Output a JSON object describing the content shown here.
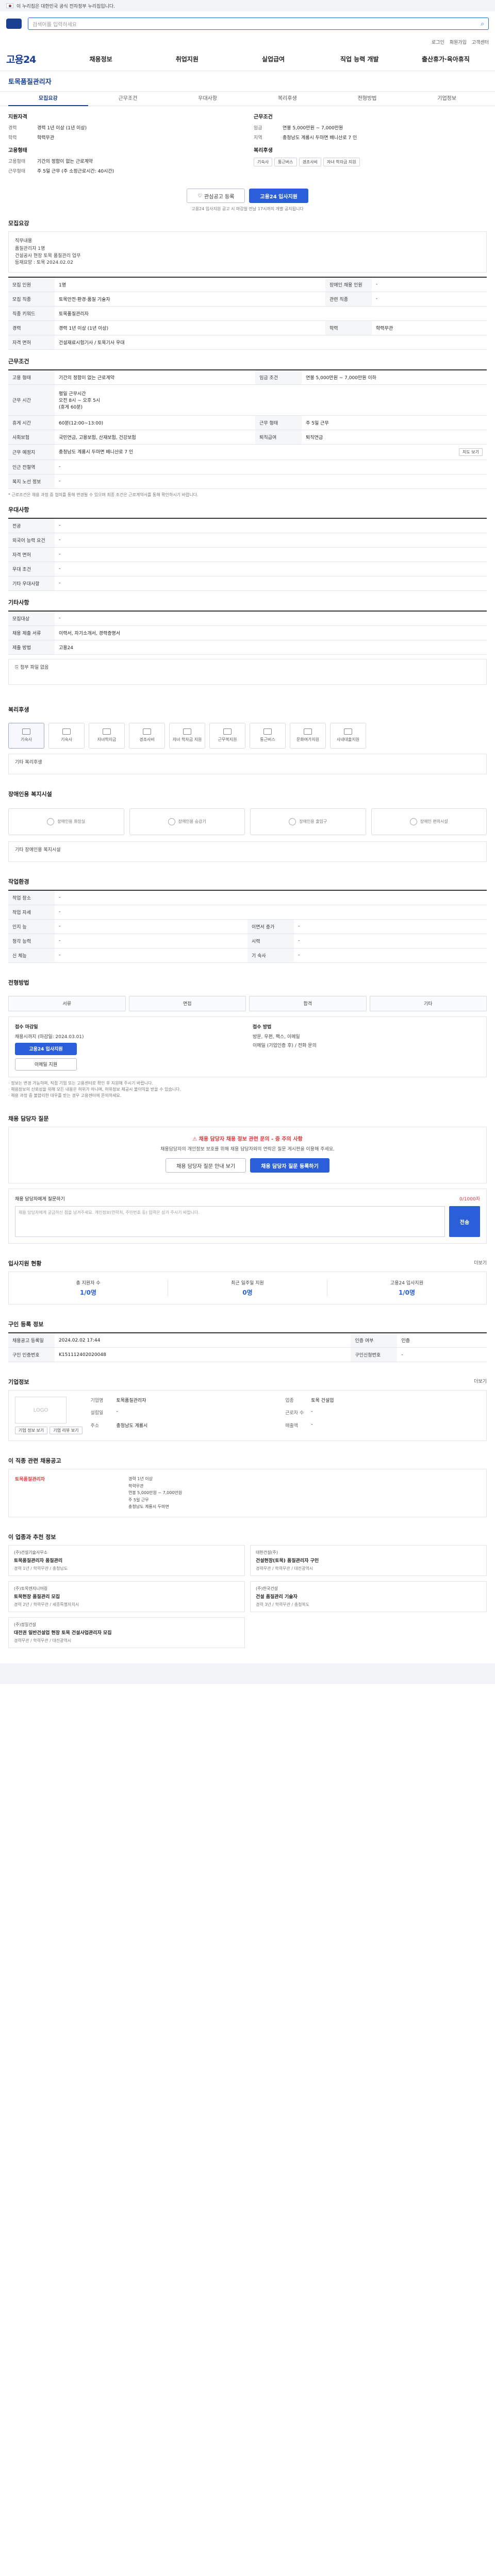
{
  "gov_banner": "이 누리집은 대한민국 공식 전자정부 누리집입니다.",
  "search": {
    "placeholder": "검색어를 입력하세요"
  },
  "util": [
    "로그인",
    "회원가입",
    "고객센터"
  ],
  "gnb": {
    "logo": "고용24",
    "items": [
      "채용정보",
      "취업지원",
      "실업급여",
      "직업 능력 개발",
      "출산휴가·육아휴직"
    ]
  },
  "job": {
    "title": "토목품질관리자",
    "status": "채용마감"
  },
  "tabs": [
    "모집요강",
    "근무조건",
    "우대사항",
    "복리후생",
    "전형방법",
    "기업정보"
  ],
  "summary": {
    "left_title": "지원자격",
    "left": [
      {
        "k": "경력",
        "v": "경력 1년 이상 (1년 이상)"
      },
      {
        "k": "학력",
        "v": "학력무관"
      }
    ],
    "left2_title": "고용형태",
    "left2": [
      {
        "k": "고용형태",
        "v": "기간의 정함이 없는 근로계약"
      },
      {
        "k": "근무형태",
        "v": "주 5일 근무 (주 소정근로시간: 40시간)"
      }
    ],
    "right_title": "근무조건",
    "right": [
      {
        "k": "임금",
        "v": "연봉 5,000만원 ~ 7,000만원"
      },
      {
        "k": "지역",
        "v": "충청남도 계룡시 두마면 배니산로 7 인"
      }
    ],
    "right2_title": "복리후생",
    "chips": [
      "기숙사",
      "통근버스",
      "경조사비",
      "자녀 학자금 지원"
    ]
  },
  "buttons": {
    "save": "관심공고 등록",
    "apply": "고용24 입사지원"
  },
  "notice_small": "고용24 입사지원 공고 시 마감일 전날 17시까지 개별 공지됩니다",
  "recruit": {
    "title": "모집요강",
    "job_content_label": "직무내용",
    "job_content": "품질관리자 1명\n건설공사 현장 토목 품질관리 업무\n등재요망 : 토목 2024.02.02",
    "rows": [
      {
        "k": "모집 인원",
        "v": "1명",
        "k2": "장애인 채용 인원",
        "v2": "-"
      },
      {
        "k": "모집 직종",
        "v": "토목안전·환경·품질 기술자",
        "k2": "관련 직종",
        "v2": "-"
      },
      {
        "k": "직종 키워드",
        "v": "토목품질관리자",
        "k2": "",
        "v2": ""
      },
      {
        "k": "경력",
        "v": "경력 1년 이상 (1년 이상)",
        "k2": "학력",
        "v2": "학력무관"
      },
      {
        "k": "자격 면허",
        "v": "건설재료시험기사 / 토목기사 우대",
        "k2": "",
        "v2": ""
      }
    ]
  },
  "conditions": {
    "title": "근무조건",
    "rows": [
      {
        "k": "고용 형태",
        "v": "기간의 정함이 없는 근로계약",
        "k2": "임금 조건",
        "v2": "연봉 5,000만원 ~ 7,000만원 이하"
      },
      {
        "k": "근무 시간",
        "v": "평일 근무시간\n오전 8시 ~ 오후 5시\n(휴게 60분)",
        "k2": "",
        "v2": ""
      },
      {
        "k": "휴게 시간",
        "v": "60분(12:00~13:00)",
        "k2": "근무 형태",
        "v2": "주 5일 근무"
      },
      {
        "k": "사회보험",
        "v": "국민연금, 고용보험, 산재보험, 건강보험",
        "k2": "퇴직급여",
        "v2": "퇴직연금"
      },
      {
        "k": "근무 예정지",
        "v": "충청남도 계룡시 두마면 배니산로 7 인",
        "k2": "",
        "v2": ""
      },
      {
        "k": "인근 전철역",
        "v": "-",
        "k2": "",
        "v2": ""
      },
      {
        "k": "복지 노선 정보",
        "v": "-",
        "k2": "",
        "v2": ""
      }
    ],
    "map_btn": "지도 보기",
    "footnote": "* 근로조건은 채용 과정 중 협의를 통해 변경될 수 있으며 최종 조건은 근로계약서를 통해 확인하시기 바랍니다."
  },
  "prefer": {
    "title": "우대사항",
    "rows": [
      {
        "k": "전공",
        "v": "-"
      },
      {
        "k": "외국어 능력 요건",
        "v": "-"
      },
      {
        "k": "자격 면허",
        "v": "-"
      },
      {
        "k": "우대 조건",
        "v": "-"
      },
      {
        "k": "기타 우대사항",
        "v": "-"
      }
    ]
  },
  "etc": {
    "title": "기타사항",
    "rows": [
      {
        "k": "모집대상",
        "v": "-"
      },
      {
        "k": "채용 제출 서류",
        "v": "이력서, 자기소개서, 경력증명서"
      },
      {
        "k": "제출 방법",
        "v": "고용24"
      }
    ],
    "attachment": "첨부 파일 없음"
  },
  "welfare": {
    "title": "복리후생",
    "items": [
      {
        "label": "기숙사",
        "on": true
      },
      {
        "label": "기숙사",
        "on": false
      },
      {
        "label": "자녀학자금",
        "on": false
      },
      {
        "label": "경조사비",
        "on": false
      },
      {
        "label": "자녀 학자금 지원",
        "on": false
      },
      {
        "label": "근무복지원",
        "on": false
      },
      {
        "label": "통근버스",
        "on": false
      },
      {
        "label": "문화여가지원",
        "on": false
      },
      {
        "label": "사내대출지원",
        "on": false
      }
    ],
    "note": "기타 복리후생"
  },
  "disability": {
    "title": "장애인용 복지시설",
    "items": [
      "장애인용 화장실",
      "장애인용 승강기",
      "장애인용 출입구",
      "장애인 편의시설"
    ],
    "note": "기타 장애인용 복지시설"
  },
  "jobenv": {
    "title": "작업환경",
    "rows": [
      {
        "k": "작업 장소",
        "v": "-",
        "k2": "",
        "v2": ""
      },
      {
        "k": "작업 자세",
        "v": "-",
        "k2": "",
        "v2": ""
      },
      {
        "k": "인지 능",
        "v": "-",
        "k2": "이면서 증가",
        "v2": "-"
      },
      {
        "k": "청각 능력",
        "v": "-",
        "k2": "시력",
        "v2": "-"
      },
      {
        "k": "신 체능",
        "v": "-",
        "k2": "기 숙사",
        "v2": "-"
      }
    ]
  },
  "process": {
    "title": "전형방법",
    "steps": [
      "서류",
      "면접",
      "합격",
      "기타"
    ]
  },
  "apply": {
    "left_title": "접수 마감일",
    "deadline": "채용시까지 (마감일: 2024.03.01)",
    "apply_btn": "고용24 입사지원",
    "mail_btn": "이메일 지원",
    "right_title": "접수 방법",
    "method": "방문, 우편, 팩스, 이메일",
    "contact": "이메일 (기업인증 후) / 전화 문의"
  },
  "apply_notes": [
    "· 정보는 변경 가능하며, 직접 기업 또는 고용센터로 확인 후 지원해 주시기 바랍니다.",
    "· 채용정보의 신뢰성을 위해 모든 내용은 허위가 아니며, 허위정보 제공시 불이익을 받을 수 있습니다.",
    "· 채용 과정 중 불합리한 대우를 받는 경우 고용센터에 문의하세요."
  ],
  "qa": {
    "title": "채용 담당자 질문",
    "warn": "채용 담당자 채용 정보 관련 문의 - 중 주의 사항",
    "desc": "채용담당자의 개인정보 보호를 위해 채용 담당자와의 연락은 질문 게시판을 이용해 주세요.",
    "btn1": "채용 담당자 질문 안내 보기",
    "btn2": "채용 담당자 질문 등록하기",
    "form_title": "채용 담당자에게 질문하기",
    "form_hint": "0/1000자",
    "input_placeholder": "채용 담당자에게 궁금하신 점을 남겨주세요. 개인정보(연락처, 주민번호 등) 입력은 삼가 주시기 바랍니다.",
    "submit": "전송"
  },
  "stats": {
    "title": "입사지원 현황",
    "more": "더보기",
    "items": [
      {
        "lbl": "총 지원자 수",
        "num": "1/0명"
      },
      {
        "lbl": "최근 일주일 지원",
        "num": "0명"
      },
      {
        "lbl": "고용24 입사지원",
        "num": "1/0명"
      }
    ]
  },
  "reg": {
    "title": "구인 등록 정보",
    "rows": [
      {
        "k": "채용공고 등록일",
        "v": "2024.02.02 17:44",
        "k2": "인증 여부",
        "v2": "인증"
      },
      {
        "k": "구인 인증번호",
        "v": "K151112402020048",
        "k2": "구인신청번호",
        "v2": "-"
      }
    ]
  },
  "company": {
    "title": "기업정보",
    "more": "더보기",
    "logo_text": "LOGO",
    "buttons": [
      "기업 정보 보기",
      "기업 리뷰 보기"
    ],
    "info": [
      {
        "k": "기업명",
        "v": "토목품질관리자"
      },
      {
        "k": "업종",
        "v": "토목 건설업"
      },
      {
        "k": "설립일",
        "v": "-"
      },
      {
        "k": "근로자 수",
        "v": "-"
      },
      {
        "k": "주소",
        "v": "충청남도 계룡시"
      },
      {
        "k": "매출액",
        "v": "-"
      }
    ]
  },
  "similar": {
    "title": "이 직종 관련 채용공고",
    "item_title": "토목품질관리자",
    "list": [
      "경력 1년 이상",
      "학력무관",
      "연봉 5,000만원 ~ 7,000만원",
      "주 5일 근무",
      "충청남도 계룡시 두마면"
    ]
  },
  "recommend": {
    "title": "이 업종과 추천 정보",
    "cards": [
      {
        "co": "(주)건설기술사무소",
        "title": "토목품질관리자 품질관리",
        "meta": "경력 1년 / 학력무관 / 충청남도"
      },
      {
        "co": "대한건설(주)",
        "title": "건설현장(토목) 품질관리자 구인",
        "meta": "경력무관 / 학력무관 / 대전광역시"
      },
      {
        "co": "(주)토목엔지니어링",
        "title": "토목현장 품질관리 모집",
        "meta": "경력 2년 / 학력무관 / 세종특별자치시"
      },
      {
        "co": "(주)한국건설",
        "title": "건설 품질관리 기술자",
        "meta": "경력 3년 / 학력무관 / 충청북도"
      },
      {
        "co": "(주)정밀건설",
        "title": "대전권 일반건설업 현장 토목 건설사업관리자 모집",
        "meta": "경력무관 / 학력무관 / 대전광역시"
      }
    ]
  }
}
